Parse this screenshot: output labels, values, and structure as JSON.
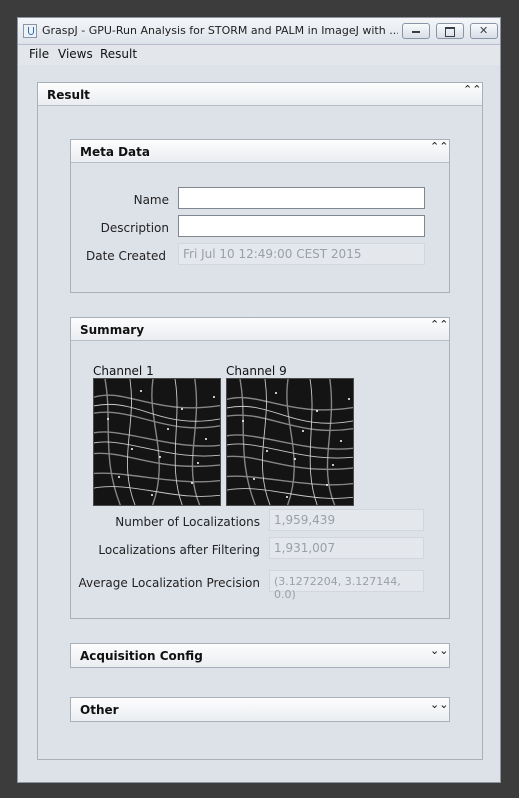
{
  "window": {
    "title": "GraspJ - GPU-Run Analysis for STORM and PALM in ImageJ with ...",
    "close_glyph": "✕"
  },
  "menu": [
    "File",
    "Views",
    "Result"
  ],
  "icons": {
    "collapse": "⌃⌃",
    "expand": "⌄⌄"
  },
  "result_panel": {
    "title": "Result"
  },
  "meta_data": {
    "title": "Meta Data",
    "name_label": "Name",
    "name_value": "",
    "description_label": "Description",
    "description_value": "",
    "date_label": "Date Created",
    "date_value": "Fri Jul 10 12:49:00 CEST 2015"
  },
  "summary": {
    "title": "Summary",
    "channels": [
      "Channel 1",
      "Channel 9"
    ],
    "num_loc_label": "Number of Localizations",
    "num_loc_value": "1,959,439",
    "filtered_label": "Localizations after Filtering",
    "filtered_value": "1,931,007",
    "precision_label": "Average Localization Precision",
    "precision_value": "(3.1272204, 3.127144, 0.0)"
  },
  "acquisition_config": {
    "title": "Acquisition Config"
  },
  "other": {
    "title": "Other"
  }
}
